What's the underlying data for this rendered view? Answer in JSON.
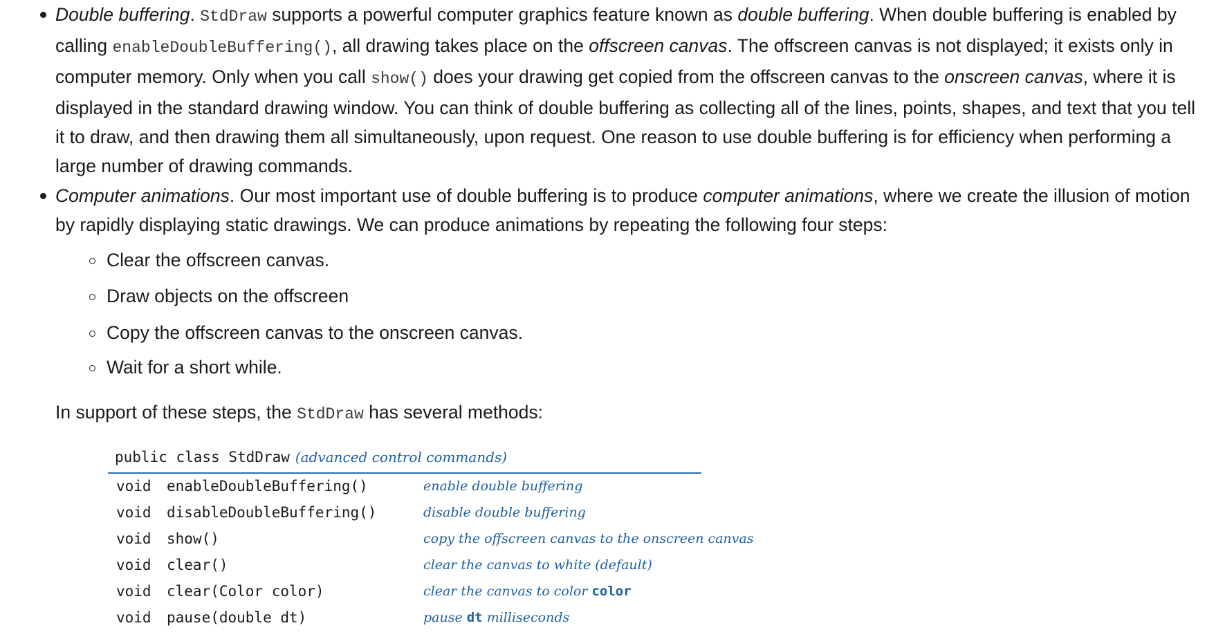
{
  "bullets": [
    {
      "term": "Double buffering",
      "segments": [
        {
          "t": ". ",
          "s": "plain"
        },
        {
          "t": "StdDraw",
          "s": "code"
        },
        {
          "t": " supports a powerful computer graphics feature known as ",
          "s": "plain"
        },
        {
          "t": "double buffering",
          "s": "em"
        },
        {
          "t": ". When double buffering is enabled by calling ",
          "s": "plain"
        },
        {
          "t": "enableDoubleBuffering()",
          "s": "code"
        },
        {
          "t": ", all drawing takes place on the ",
          "s": "plain"
        },
        {
          "t": "offscreen canvas",
          "s": "em"
        },
        {
          "t": ". The offscreen canvas is not displayed; it exists only in computer memory. Only when you call ",
          "s": "plain"
        },
        {
          "t": "show()",
          "s": "code"
        },
        {
          "t": " does your drawing get copied from the offscreen canvas to the ",
          "s": "plain"
        },
        {
          "t": "onscreen canvas",
          "s": "em"
        },
        {
          "t": ", where it is displayed in the standard drawing window. You can think of double buffering as collecting all of the lines, points, shapes, and text that you tell it to draw, and then drawing them all simultaneously, upon request. One reason to use double buffering is for efficiency when performing a large number of drawing commands.",
          "s": "plain"
        }
      ]
    },
    {
      "term": "Computer animations",
      "segments": [
        {
          "t": ". Our most important use of double buffering is to produce ",
          "s": "plain"
        },
        {
          "t": "computer animations",
          "s": "em"
        },
        {
          "t": ", where we create the illusion of motion by rapidly displaying static drawings. We can produce animations by repeating the following four steps:",
          "s": "plain"
        }
      ]
    }
  ],
  "steps": [
    "Clear the offscreen canvas.",
    "Draw objects on the offscreen",
    "Copy the offscreen canvas to the onscreen canvas.",
    "Wait for a short while."
  ],
  "support": {
    "before": "In support of these steps, the ",
    "code": "StdDraw",
    "after": " has several methods:"
  },
  "api": {
    "header_signature": "public class StdDraw",
    "header_description": "(advanced control commands)",
    "rows": [
      {
        "type": "void",
        "method": "enableDoubleBuffering()",
        "desc": "enable double buffering",
        "desc_code": ""
      },
      {
        "type": "void",
        "method": "disableDoubleBuffering()",
        "desc": "disable double buffering",
        "desc_code": ""
      },
      {
        "type": "void",
        "method": "show()",
        "desc": "copy the offscreen canvas to the onscreen canvas",
        "desc_code": ""
      },
      {
        "type": "void",
        "method": "clear()",
        "desc": "clear the canvas to white (default)",
        "desc_code": ""
      },
      {
        "type": "void",
        "method": "clear(Color color)",
        "desc": "clear the canvas to color ",
        "desc_code": "color"
      },
      {
        "type": "void",
        "method": "pause(double dt)",
        "desc": "pause ",
        "desc_code": "dt",
        "desc_after": " milliseconds"
      }
    ]
  },
  "colors": {
    "text": "#1a1a1a",
    "api_accent": "#1f5fa0",
    "rule": "#2a6fb0"
  }
}
